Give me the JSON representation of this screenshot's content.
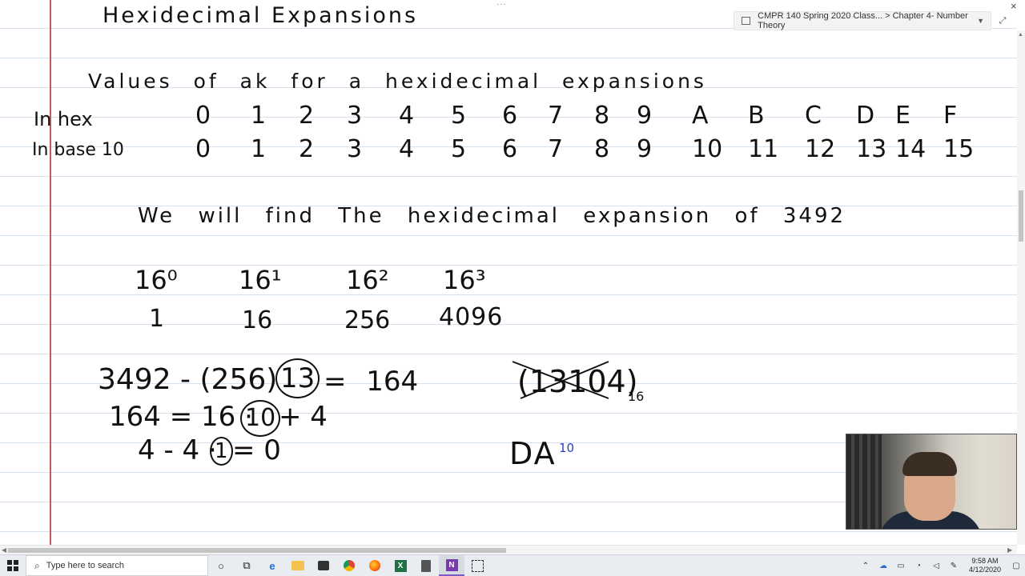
{
  "page": {
    "title": "Hexidecimal Expansions",
    "heading": "Values of ak for a hexidecimal expansions"
  },
  "table": {
    "hex_label": "In hex",
    "base10_label": "In base 10",
    "hex_values": [
      "0",
      "1",
      "2",
      "3",
      "4",
      "5",
      "6",
      "7",
      "8",
      "9",
      "A",
      "B",
      "C",
      "D",
      "E",
      "F"
    ],
    "base10_values": [
      "0",
      "1",
      "2",
      "3",
      "4",
      "5",
      "6",
      "7",
      "8",
      "9",
      "10",
      "11",
      "12",
      "13",
      "14",
      "15"
    ]
  },
  "problem": {
    "statement": "We will find The hexidecimal expansion of 3492",
    "powers": [
      "16⁰",
      "16¹",
      "16²",
      "16³"
    ],
    "power_values": [
      "1",
      "16",
      "256",
      "4096"
    ],
    "steps": [
      {
        "left": "3492 - (256)",
        "digit": "13",
        "right": "= 164"
      },
      {
        "left": "164 = 16 ·",
        "digit": "10",
        "right": "+ 4"
      },
      {
        "left": "4 - 4 ·",
        "digit": "1",
        "right": "= 0"
      }
    ],
    "crossed_result": "(13104)",
    "crossed_base": "16",
    "answer_partial": "DA",
    "answer_superscript": "10"
  },
  "onenote": {
    "breadcrumb": "CMPR 140 Spring 2020 Class... > Chapter 4- Number Theory",
    "dots": "···",
    "close": "×"
  },
  "taskbar": {
    "search_placeholder": "Type here to search",
    "time": "9:58 AM",
    "date": "4/12/2020"
  },
  "colors": {
    "ink": "#111111",
    "rule_lines": "#d5e3f1",
    "margin_line": "#c55a5a",
    "pen_blue": "#2a3fc7"
  }
}
